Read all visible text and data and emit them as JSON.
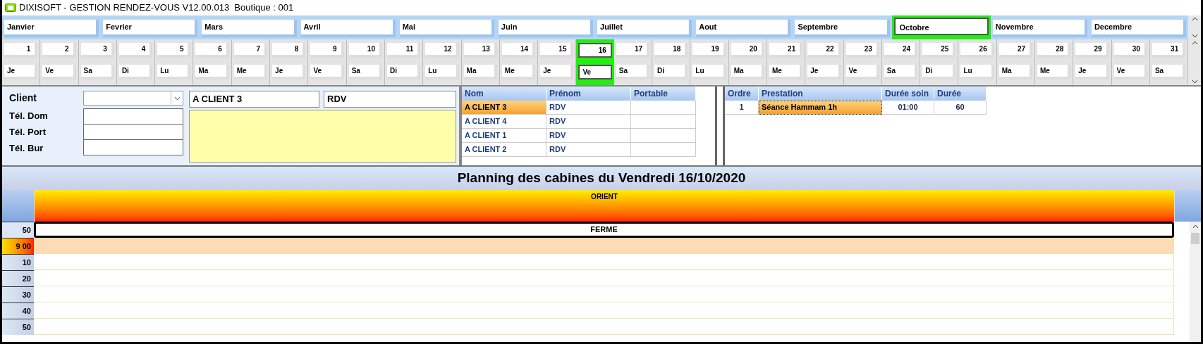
{
  "window": {
    "title": "DIXISOFT - GESTION RENDEZ-VOUS V12.00.013  Boutique : 001"
  },
  "months": [
    {
      "label": "Janvier",
      "selected": false
    },
    {
      "label": "Fevrier",
      "selected": false
    },
    {
      "label": "Mars",
      "selected": false
    },
    {
      "label": "Avril",
      "selected": false
    },
    {
      "label": "Mai",
      "selected": false
    },
    {
      "label": "Juin",
      "selected": false
    },
    {
      "label": "Juillet",
      "selected": false
    },
    {
      "label": "Aout",
      "selected": false
    },
    {
      "label": "Septembre",
      "selected": false
    },
    {
      "label": "Octobre",
      "selected": true
    },
    {
      "label": "Novembre",
      "selected": false
    },
    {
      "label": "Decembre",
      "selected": false
    }
  ],
  "days": [
    {
      "number": "1",
      "weekday": "Je",
      "selected": false
    },
    {
      "number": "2",
      "weekday": "Ve",
      "selected": false
    },
    {
      "number": "3",
      "weekday": "Sa",
      "selected": false
    },
    {
      "number": "4",
      "weekday": "Di",
      "selected": false
    },
    {
      "number": "5",
      "weekday": "Lu",
      "selected": false
    },
    {
      "number": "6",
      "weekday": "Ma",
      "selected": false
    },
    {
      "number": "7",
      "weekday": "Me",
      "selected": false
    },
    {
      "number": "8",
      "weekday": "Je",
      "selected": false
    },
    {
      "number": "9",
      "weekday": "Ve",
      "selected": false
    },
    {
      "number": "10",
      "weekday": "Sa",
      "selected": false
    },
    {
      "number": "11",
      "weekday": "Di",
      "selected": false
    },
    {
      "number": "12",
      "weekday": "Lu",
      "selected": false
    },
    {
      "number": "13",
      "weekday": "Ma",
      "selected": false
    },
    {
      "number": "14",
      "weekday": "Me",
      "selected": false
    },
    {
      "number": "15",
      "weekday": "Je",
      "selected": false
    },
    {
      "number": "16",
      "weekday": "Ve",
      "selected": true
    },
    {
      "number": "17",
      "weekday": "Sa",
      "selected": false
    },
    {
      "number": "18",
      "weekday": "Di",
      "selected": false
    },
    {
      "number": "19",
      "weekday": "Lu",
      "selected": false
    },
    {
      "number": "20",
      "weekday": "Ma",
      "selected": false
    },
    {
      "number": "21",
      "weekday": "Me",
      "selected": false
    },
    {
      "number": "22",
      "weekday": "Je",
      "selected": false
    },
    {
      "number": "23",
      "weekday": "Ve",
      "selected": false
    },
    {
      "number": "24",
      "weekday": "Sa",
      "selected": false
    },
    {
      "number": "25",
      "weekday": "Di",
      "selected": false
    },
    {
      "number": "26",
      "weekday": "Lu",
      "selected": false
    },
    {
      "number": "27",
      "weekday": "Ma",
      "selected": false
    },
    {
      "number": "28",
      "weekday": "Me",
      "selected": false
    },
    {
      "number": "29",
      "weekday": "Je",
      "selected": false
    },
    {
      "number": "30",
      "weekday": "Ve",
      "selected": false
    },
    {
      "number": "31",
      "weekday": "Sa",
      "selected": false
    }
  ],
  "client_form": {
    "client_label": "Client",
    "name": "A CLIENT 3",
    "type": "RDV",
    "phones": [
      {
        "label": "Tél. Dom"
      },
      {
        "label": "Tél. Port"
      },
      {
        "label": "Tél. Bur"
      }
    ]
  },
  "clients_table": {
    "columns": [
      "Nom",
      "Prénom",
      "Portable"
    ],
    "rows": [
      {
        "cells": [
          "A CLIENT 3",
          "RDV"
        ],
        "selected": true
      },
      {
        "cells": [
          "A CLIENT 4",
          "RDV"
        ],
        "selected": false
      },
      {
        "cells": [
          "A CLIENT 1",
          "RDV"
        ],
        "selected": false
      },
      {
        "cells": [
          "A CLIENT 2",
          "RDV"
        ],
        "selected": false
      }
    ]
  },
  "services_table": {
    "columns": [
      "Ordre",
      "Prestation",
      "Durée soin",
      "Durée"
    ],
    "rows": [
      {
        "cells": [
          "1",
          "Séance Hammam 1h",
          "01:00",
          "60"
        ],
        "selected": true
      }
    ]
  },
  "planning": {
    "title": "Planning des cabines du Vendredi 16/10/2020",
    "cabin": "ORIENT",
    "slots": [
      {
        "time": "50",
        "kind": "closed",
        "text": "FERME"
      },
      {
        "time": "9 00",
        "kind": "current"
      },
      {
        "time": "10",
        "kind": "normal"
      },
      {
        "time": "20",
        "kind": "normal"
      },
      {
        "time": "30",
        "kind": "normal"
      },
      {
        "time": "40",
        "kind": "normal"
      },
      {
        "time": "50",
        "kind": "normal"
      }
    ]
  }
}
